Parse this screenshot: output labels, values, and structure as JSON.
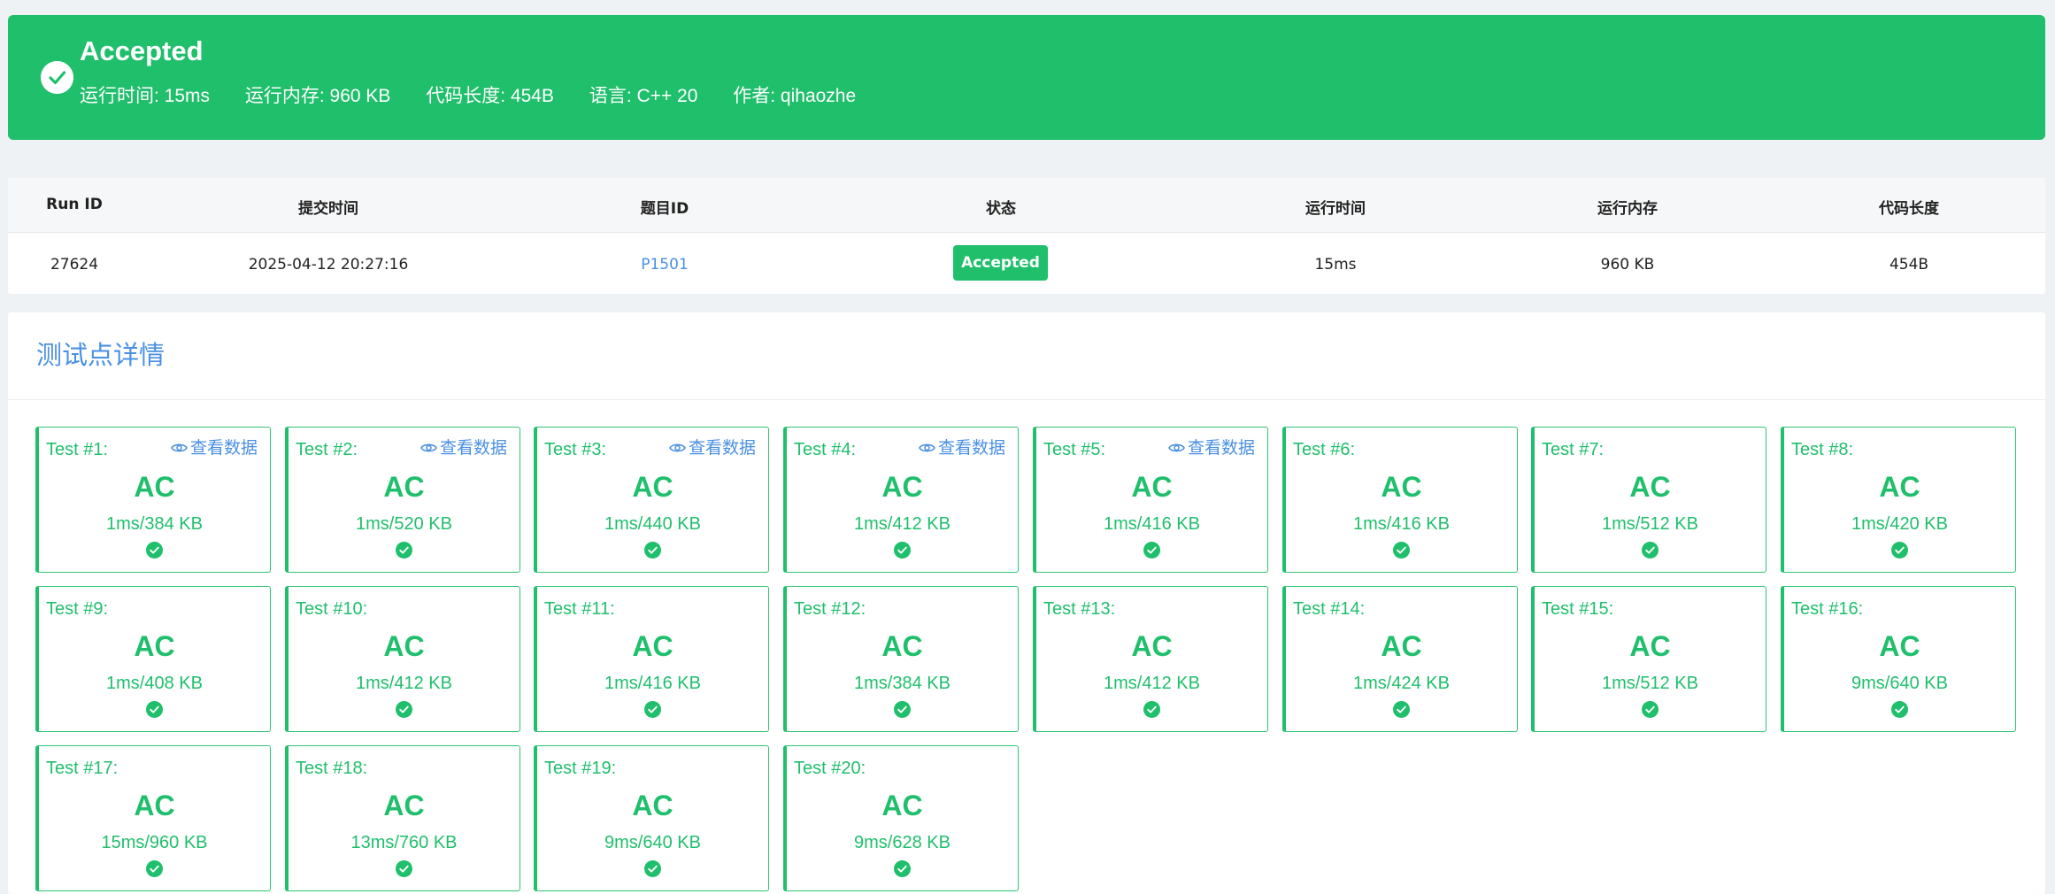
{
  "banner": {
    "title": "Accepted",
    "meta": [
      "运行时间: 15ms",
      "运行内存: 960 KB",
      "代码长度: 454B",
      "语言: C++ 20",
      "作者: qihaozhe"
    ],
    "color": "#1fbf6b"
  },
  "submission_table": {
    "headers": [
      "Run ID",
      "提交时间",
      "题目ID",
      "状态",
      "运行时间",
      "运行内存",
      "代码长度"
    ],
    "row": {
      "run_id": "27624",
      "submit_time": "2025-04-12 20:27:16",
      "problem_id": "P1501",
      "status": "Accepted",
      "run_time": "15ms",
      "memory": "960 KB",
      "code_length": "454B"
    }
  },
  "test_points": {
    "title": "测试点详情",
    "view_data_label": "查看数据",
    "tests": [
      {
        "label": "Test #1:",
        "verdict": "AC",
        "usage": "1ms/384 KB",
        "has_view": true
      },
      {
        "label": "Test #2:",
        "verdict": "AC",
        "usage": "1ms/520 KB",
        "has_view": true
      },
      {
        "label": "Test #3:",
        "verdict": "AC",
        "usage": "1ms/440 KB",
        "has_view": true
      },
      {
        "label": "Test #4:",
        "verdict": "AC",
        "usage": "1ms/412 KB",
        "has_view": true
      },
      {
        "label": "Test #5:",
        "verdict": "AC",
        "usage": "1ms/416 KB",
        "has_view": true
      },
      {
        "label": "Test #6:",
        "verdict": "AC",
        "usage": "1ms/416 KB",
        "has_view": false
      },
      {
        "label": "Test #7:",
        "verdict": "AC",
        "usage": "1ms/512 KB",
        "has_view": false
      },
      {
        "label": "Test #8:",
        "verdict": "AC",
        "usage": "1ms/420 KB",
        "has_view": false
      },
      {
        "label": "Test #9:",
        "verdict": "AC",
        "usage": "1ms/408 KB",
        "has_view": false
      },
      {
        "label": "Test #10:",
        "verdict": "AC",
        "usage": "1ms/412 KB",
        "has_view": false
      },
      {
        "label": "Test #11:",
        "verdict": "AC",
        "usage": "1ms/416 KB",
        "has_view": false
      },
      {
        "label": "Test #12:",
        "verdict": "AC",
        "usage": "1ms/384 KB",
        "has_view": false
      },
      {
        "label": "Test #13:",
        "verdict": "AC",
        "usage": "1ms/412 KB",
        "has_view": false
      },
      {
        "label": "Test #14:",
        "verdict": "AC",
        "usage": "1ms/424 KB",
        "has_view": false
      },
      {
        "label": "Test #15:",
        "verdict": "AC",
        "usage": "1ms/512 KB",
        "has_view": false
      },
      {
        "label": "Test #16:",
        "verdict": "AC",
        "usage": "9ms/640 KB",
        "has_view": false
      },
      {
        "label": "Test #17:",
        "verdict": "AC",
        "usage": "15ms/960 KB",
        "has_view": false
      },
      {
        "label": "Test #18:",
        "verdict": "AC",
        "usage": "13ms/760 KB",
        "has_view": false
      },
      {
        "label": "Test #19:",
        "verdict": "AC",
        "usage": "9ms/640 KB",
        "has_view": false
      },
      {
        "label": "Test #20:",
        "verdict": "AC",
        "usage": "9ms/628 KB",
        "has_view": false
      }
    ]
  },
  "colors": {
    "accepted": "#1fbf6b",
    "link": "#4a90e2"
  },
  "icons": {
    "banner": "check-circle-icon",
    "view_data": "eye-icon",
    "test_status": "check-circle-icon"
  }
}
